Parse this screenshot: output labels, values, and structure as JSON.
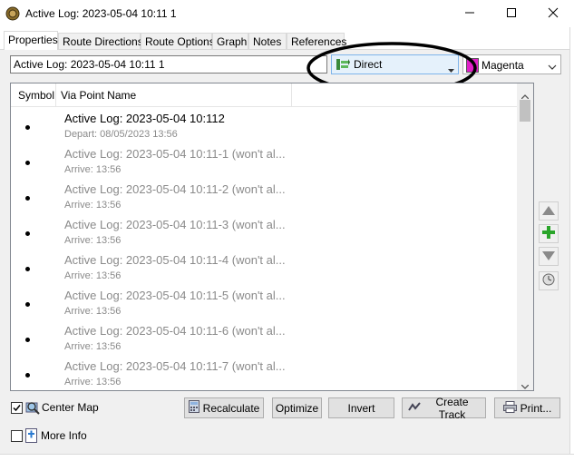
{
  "window": {
    "title": "Active Log: 2023-05-04 10:11 1"
  },
  "tabs": [
    {
      "label": "Properties"
    },
    {
      "label": "Route Directions"
    },
    {
      "label": "Route Options"
    },
    {
      "label": "Graph"
    },
    {
      "label": "Notes"
    },
    {
      "label": "References"
    }
  ],
  "route": {
    "name_value": "Active Log: 2023-05-04 10:11 1",
    "mode_label": "Direct",
    "color_label": "Magenta",
    "color_swatch": "#e020c8"
  },
  "list": {
    "col_symbol": "Symbol",
    "col_name": "Via Point Name",
    "rows": [
      {
        "name": "Active Log: 2023-05-04 10:112",
        "sub": "Depart: 08/05/2023 13:56"
      },
      {
        "name": "Active Log: 2023-05-04 10:11-1 (won't al...",
        "sub": "Arrive: 13:56"
      },
      {
        "name": "Active Log: 2023-05-04 10:11-2 (won't al...",
        "sub": "Arrive: 13:56"
      },
      {
        "name": "Active Log: 2023-05-04 10:11-3 (won't al...",
        "sub": "Arrive: 13:56"
      },
      {
        "name": "Active Log: 2023-05-04 10:11-4 (won't al...",
        "sub": "Arrive: 13:56"
      },
      {
        "name": "Active Log: 2023-05-04 10:11-5 (won't al...",
        "sub": "Arrive: 13:56"
      },
      {
        "name": "Active Log: 2023-05-04 10:11-6 (won't al...",
        "sub": "Arrive: 13:56"
      },
      {
        "name": "Active Log: 2023-05-04 10:11-7 (won't al...",
        "sub": "Arrive: 13:56"
      }
    ]
  },
  "bottom": {
    "center_map_label": "Center Map",
    "center_map_checked": true,
    "more_info_label": "More Info",
    "more_info_checked": false,
    "recalculate": "Recalculate",
    "optimize": "Optimize",
    "invert": "Invert",
    "create_track": "Create Track",
    "print": "Print..."
  },
  "icons": {
    "app": "garmin-globe-icon",
    "minimize": "minimize-icon",
    "maximize": "maximize-icon",
    "close": "close-icon",
    "move_up": "triangle-up-icon",
    "add": "plus-icon",
    "move_down": "triangle-down-icon",
    "clock": "clock-icon"
  }
}
